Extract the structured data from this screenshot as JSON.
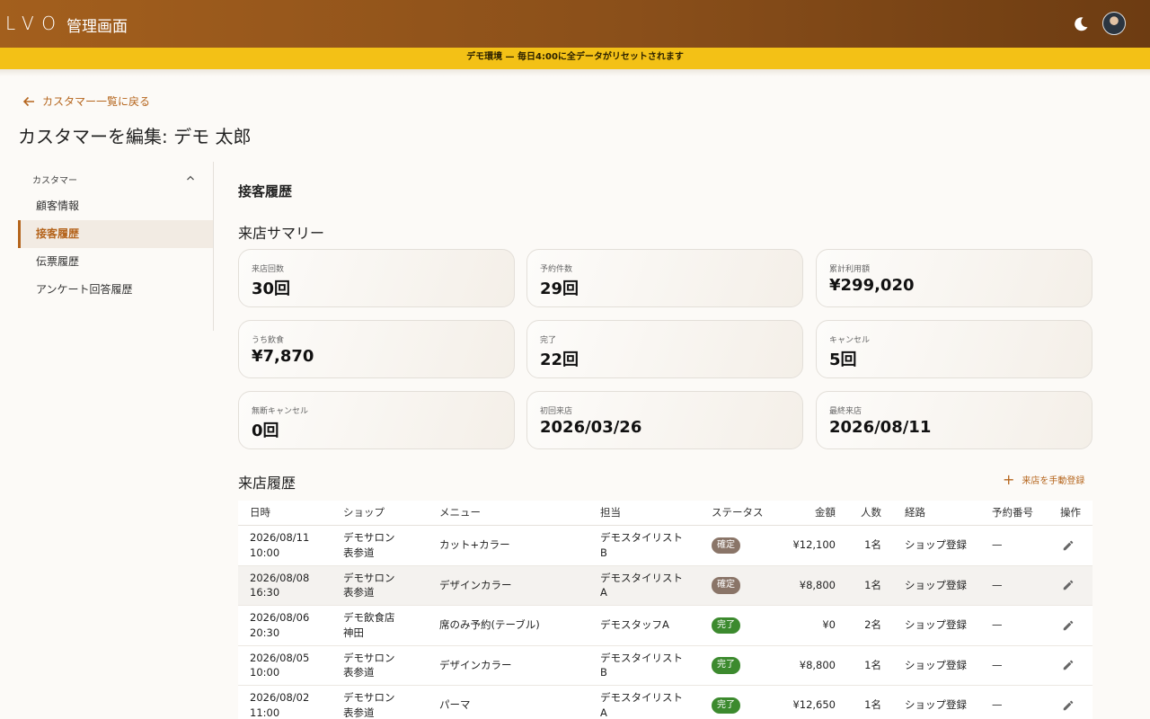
{
  "header": {
    "logo": "LVO",
    "title": "管理画面"
  },
  "banner": {
    "text": "デモ環境 — 毎日4:00に全データがリセットされます"
  },
  "back_link": "カスタマー一覧に戻る",
  "page_title": "カスタマーを編集: デモ 太郎",
  "sidebar": {
    "group": "カスタマー",
    "items": [
      {
        "label": "顧客情報",
        "active": false
      },
      {
        "label": "接客履歴",
        "active": true
      },
      {
        "label": "伝票履歴",
        "active": false
      },
      {
        "label": "アンケート回答履歴",
        "active": false
      }
    ]
  },
  "section_title": "接客履歴",
  "summary": {
    "title": "来店サマリー",
    "cards": [
      {
        "label": "来店回数",
        "value": "30回"
      },
      {
        "label": "予約件数",
        "value": "29回"
      },
      {
        "label": "累計利用額",
        "value": "¥299,020"
      },
      {
        "label": "うち飲食",
        "value": "¥7,870"
      },
      {
        "label": "完了",
        "value": "22回"
      },
      {
        "label": "キャンセル",
        "value": "5回"
      },
      {
        "label": "無断キャンセル",
        "value": "0回"
      },
      {
        "label": "初回来店",
        "value": "2026/03/26"
      },
      {
        "label": "最終来店",
        "value": "2026/08/11"
      }
    ]
  },
  "history": {
    "title": "来店履歴",
    "add_button": "来店を手動登録",
    "columns": [
      "日時",
      "ショップ",
      "メニュー",
      "担当",
      "ステータス",
      "金額",
      "人数",
      "経路",
      "予約番号",
      "操作"
    ],
    "rows": [
      {
        "date": "2026/08/11",
        "time": "10:00",
        "shop1": "デモサロン",
        "shop2": "表参道",
        "menu": "カット+カラー",
        "staff1": "デモスタイリスト",
        "staff2": "B",
        "status": "確定",
        "amount": "¥12,100",
        "people": "1名",
        "route": "ショップ登録",
        "resv": "—"
      },
      {
        "date": "2026/08/08",
        "time": "16:30",
        "shop1": "デモサロン",
        "shop2": "表参道",
        "menu": "デザインカラー",
        "staff1": "デモスタイリスト",
        "staff2": "A",
        "status": "確定",
        "amount": "¥8,800",
        "people": "1名",
        "route": "ショップ登録",
        "resv": "—"
      },
      {
        "date": "2026/08/06",
        "time": "20:30",
        "shop1": "デモ飲食店",
        "shop2": "神田",
        "menu": "席のみ予約(テーブル)",
        "staff1": "デモスタッフA",
        "staff2": "",
        "status": "完了",
        "amount": "¥0",
        "people": "2名",
        "route": "ショップ登録",
        "resv": "—"
      },
      {
        "date": "2026/08/05",
        "time": "10:00",
        "shop1": "デモサロン",
        "shop2": "表参道",
        "menu": "デザインカラー",
        "staff1": "デモスタイリスト",
        "staff2": "B",
        "status": "完了",
        "amount": "¥8,800",
        "people": "1名",
        "route": "ショップ登録",
        "resv": "—"
      },
      {
        "date": "2026/08/02",
        "time": "11:00",
        "shop1": "デモサロン",
        "shop2": "表参道",
        "menu": "パーマ",
        "staff1": "デモスタイリスト",
        "staff2": "A",
        "status": "完了",
        "amount": "¥12,650",
        "people": "1名",
        "route": "ショップ登録",
        "resv": "—"
      }
    ]
  },
  "colors": {
    "brand": "#b5651d",
    "banner": "#f3c116",
    "confirmed": "#8a7568",
    "completed": "#3c8a2e"
  }
}
